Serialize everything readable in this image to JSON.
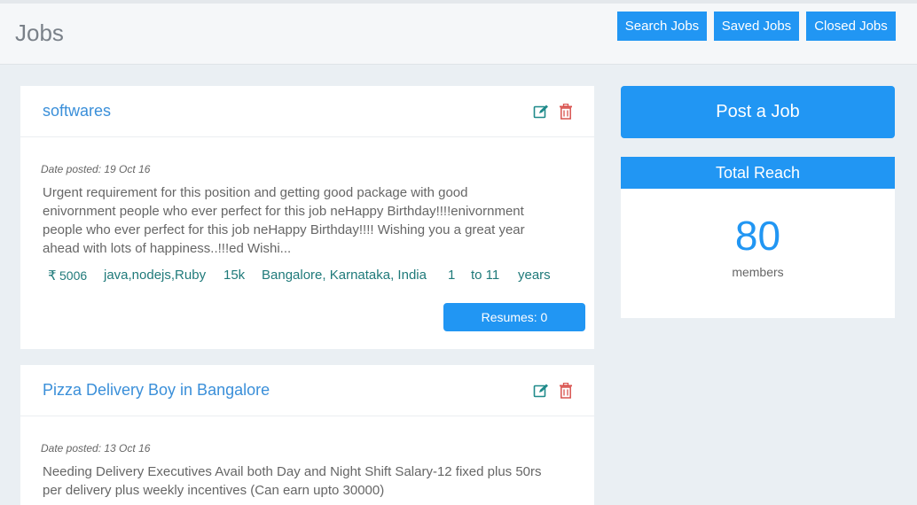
{
  "header": {
    "title": "Jobs",
    "buttons": {
      "search": "Search Jobs",
      "saved": "Saved Jobs",
      "closed": "Closed Jobs"
    }
  },
  "jobs": [
    {
      "title": "softwares",
      "date": "Date posted: 19 Oct 16",
      "description_lines": [
        "Urgent requirement for this position and getting good package with good",
        "enivornment people who ever perfect for this job neHappy Birthday!!!!enivornment",
        "people who ever perfect for this job neHappy Birthday!!!! Wishing you a great year",
        "ahead with lots of happiness..!!!ed Wishi..."
      ],
      "currency_symbol": "₹",
      "salary": "5006",
      "skills": "java,nodejs,Ruby",
      "package": "15k",
      "location": "Bangalore, Karnataka, India",
      "exp_min": "1",
      "exp_to": "to 11",
      "exp_unit": "years",
      "resumes": "Resumes: 0"
    },
    {
      "title": "Pizza Delivery Boy in Bangalore",
      "date": "Date posted: 13 Oct 16",
      "description_lines": [
        "Needing Delivery Executives Avail both Day and Night Shift Salary-12 fixed plus 50rs",
        "per delivery plus weekly incentives (Can earn upto 30000)"
      ]
    }
  ],
  "sidebar": {
    "post_job": "Post a Job",
    "reach_title": "Total Reach",
    "reach_count": "80",
    "reach_label": "members"
  },
  "colors": {
    "accent": "#2196f3",
    "link": "#3a8fd9",
    "meta": "#1f7a7a",
    "edit": "#1f8a8a",
    "delete": "#d9534f"
  },
  "icons": {
    "edit": "edit-icon",
    "delete": "trash-icon",
    "currency": "rupee-icon"
  }
}
